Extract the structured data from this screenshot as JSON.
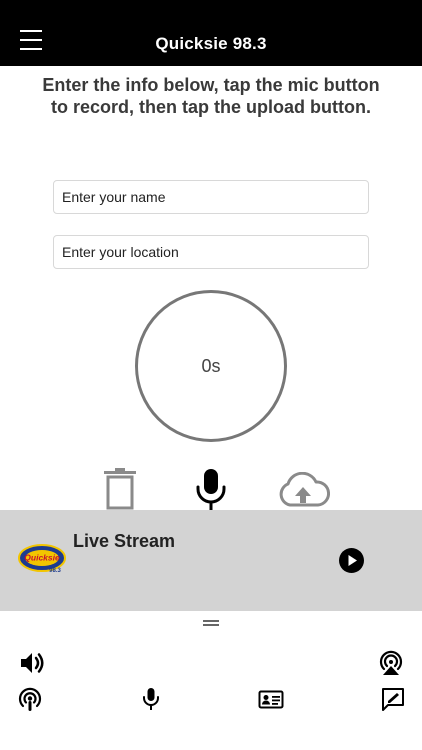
{
  "header": {
    "title": "Quicksie 98.3",
    "menu_icon": "hamburger-menu-icon"
  },
  "instructions": "Enter the info below, tap the mic button to record, then tap the upload button.",
  "form": {
    "name_placeholder": "Enter your name",
    "location_placeholder": "Enter your location"
  },
  "recorder": {
    "timer": "0s",
    "delete_icon": "trash-icon",
    "record_icon": "microphone-icon",
    "upload_icon": "cloud-upload-icon"
  },
  "player": {
    "title": "Live Stream",
    "logo_text": "Quicksie",
    "logo_sub": "98.3",
    "play_icon": "play-icon"
  },
  "bottom_nav": {
    "row1": [
      "volume-icon",
      "airplay-icon"
    ],
    "row2": [
      "podcast-icon",
      "microphone-icon",
      "contact-card-icon",
      "feedback-icon"
    ]
  },
  "colors": {
    "header_bg": "#000000",
    "player_bg": "#d3d3d3",
    "text_dark": "#222222",
    "icon_gray": "#8a8a8a"
  }
}
